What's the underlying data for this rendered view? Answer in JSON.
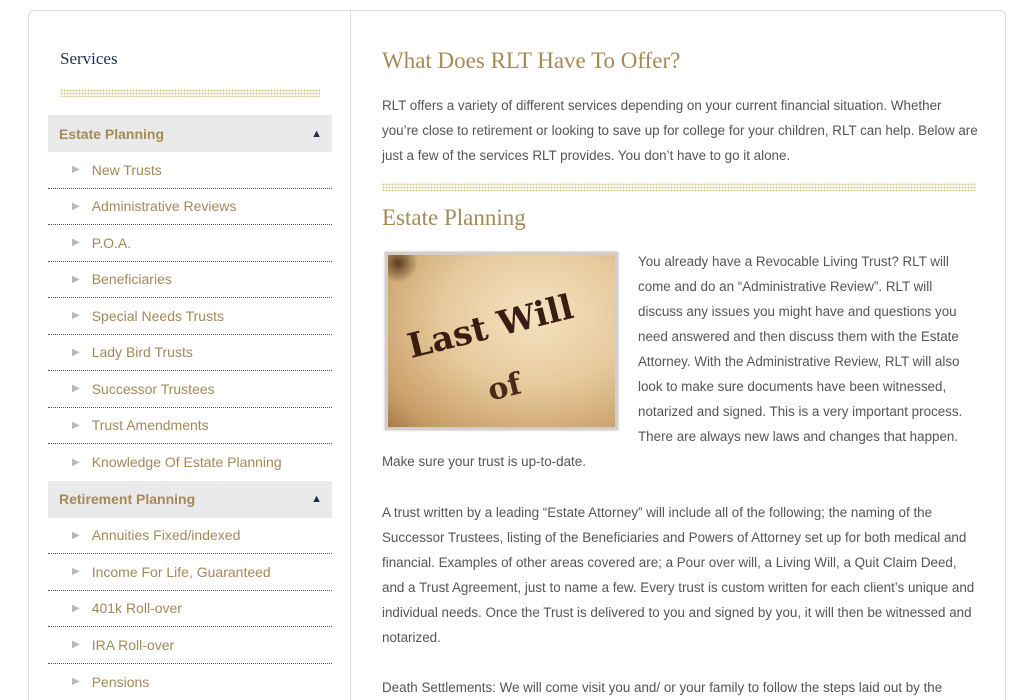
{
  "sidebar": {
    "title": "Services",
    "groups": [
      {
        "label": "Estate Planning",
        "expanded_icon": "triangle-up-icon",
        "items": [
          "New Trusts",
          "Administrative Reviews",
          "P.O.A.",
          "Beneficiaries",
          "Special Needs Trusts",
          "Lady Bird Trusts",
          "Successor Trustees",
          "Trust Amendments",
          "Knowledge Of Estate Planning"
        ]
      },
      {
        "label": "Retirement Planning",
        "expanded_icon": "triangle-up-icon",
        "items": [
          "Annuities Fixed/indexed",
          "Income For Life, Guaranteed",
          "401k Roll-over",
          "IRA Roll-over",
          "Pensions"
        ]
      }
    ]
  },
  "main": {
    "title": "What Does RLT Have To Offer?",
    "intro": "RLT offers a variety of different services depending on your current financial situation. Whether you’re close to retirement or looking to save up for college for your children, RLT can help. Below are just a few of the services RLT provides. You don’t have to go it alone.",
    "section_title": "Estate Planning",
    "image_text_line1": "Last Will",
    "image_text_line2": "of",
    "para1": "You already have a Revocable Living Trust? RLT will come and do an “Administrative Review”. RLT will discuss any issues you might have and questions you need answered and then discuss them with the Estate Attorney. With the Administrative Review, RLT will also look to make sure documents have been witnessed, notarized and signed. This is a very important process. There are always new laws and changes that happen. Make sure your trust is up-to-date.",
    "para2": "A trust written by a leading “Estate Attorney” will include all of the following; the naming of the Successor Trustees, listing of the Beneficiaries and Powers of Attorney set up for both medical and financial. Examples of other areas covered are; a Pour over will, a Living Will, a Quit Claim Deed, and a Trust Agreement, just to name a few. Every trust is custom written for each client’s unique and individual needs. Once the Trust is delivered to you and signed by you, it will then be witnessed and notarized.",
    "para3": "Death Settlements: We will come visit you and/ or your family to follow the steps laid out by the"
  },
  "colors": {
    "accent_gold": "#a48a55",
    "navy": "#1c2f4d",
    "body_text": "#555555",
    "sidebar_head_bg": "#eaeaea"
  }
}
